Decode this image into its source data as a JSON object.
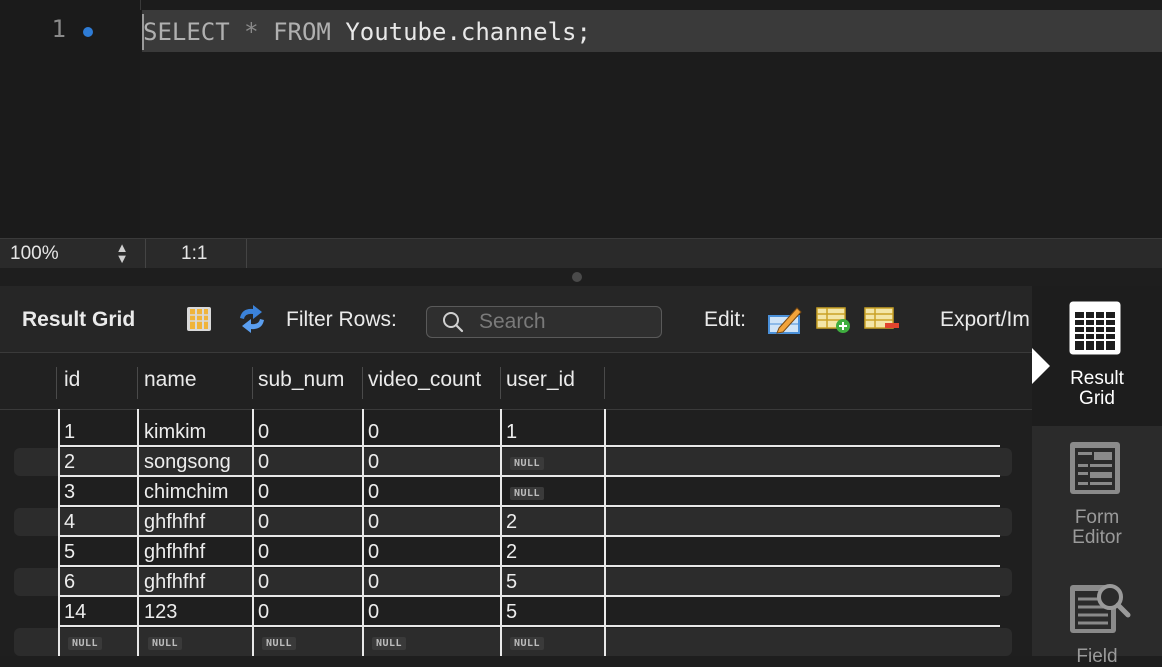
{
  "editor": {
    "line_number": "1",
    "code": {
      "select": "SELECT",
      "star": "*",
      "from": "FROM",
      "rest": "Youtube.channels;"
    }
  },
  "status": {
    "zoom": "100%",
    "position": "1:1"
  },
  "toolbar": {
    "result_grid_label": "Result Grid",
    "filter_rows_label": "Filter Rows:",
    "search_placeholder": "Search",
    "edit_label": "Edit:",
    "export_label": "Export/Im"
  },
  "grid": {
    "columns": [
      "id",
      "name",
      "sub_num",
      "video_count",
      "user_id"
    ],
    "null_text": "NULL",
    "rows": [
      [
        "1",
        "kimkim",
        "0",
        "0",
        "1"
      ],
      [
        "2",
        "songsong",
        "0",
        "0",
        "NULL"
      ],
      [
        "3",
        "chimchim",
        "0",
        "0",
        "NULL"
      ],
      [
        "4",
        "ghfhfhf",
        "0",
        "0",
        "2"
      ],
      [
        "5",
        "ghfhfhf",
        "0",
        "0",
        "2"
      ],
      [
        "6",
        "ghfhfhf",
        "0",
        "0",
        "5"
      ],
      [
        "14",
        "123",
        "0",
        "0",
        "5"
      ],
      [
        "NULL",
        "NULL",
        "NULL",
        "NULL",
        "NULL"
      ]
    ]
  },
  "side_panel": {
    "result_grid": {
      "line1": "Result",
      "line2": "Grid"
    },
    "form_editor": {
      "line1": "Form",
      "line2": "Editor"
    },
    "field_types": {
      "line1": "Field"
    }
  }
}
